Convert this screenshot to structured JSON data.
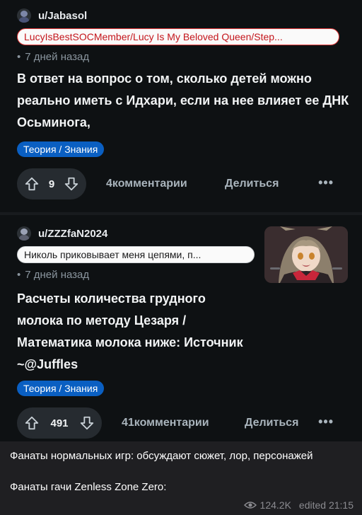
{
  "posts": [
    {
      "username": "u/Jabasol",
      "flair": "LucyIsBestSOCMember/Lucy Is My Beloved Queen/Step...",
      "time": "7 дней назад",
      "title": "В ответ на вопрос о том, сколько детей можно реально иметь с Идхари, если на нее влияет ее ДНК Осьминога,",
      "tag": "Теория / Знания",
      "votes": "9",
      "comments": "4комментарии",
      "share": "Делиться",
      "more": "•••"
    },
    {
      "username": "u/ZZZfaN2024",
      "flair": "Николь приковывает меня цепями, п...",
      "time": "7 дней назад",
      "title": "Расчеты количества грудного молока по методу Цезаря / Математика молока ниже: Источник ~@Juffles",
      "tag": "Теория / Знания",
      "votes": "491",
      "comments": "41комментарии",
      "share": "Делиться",
      "more": "•••"
    }
  ],
  "caption": {
    "line1": "Фанаты нормальных игр: обсуждают сюжет, лор, персонажей",
    "line2": "Фанаты гачи Zenless Zone Zero:",
    "views": "124.2K",
    "edited": "edited 21:15"
  },
  "colors": {
    "background": "#0e1113",
    "tag": "#0a5fc2",
    "flair_text": "#c4161c",
    "caption_bg": "#1f1f22"
  }
}
